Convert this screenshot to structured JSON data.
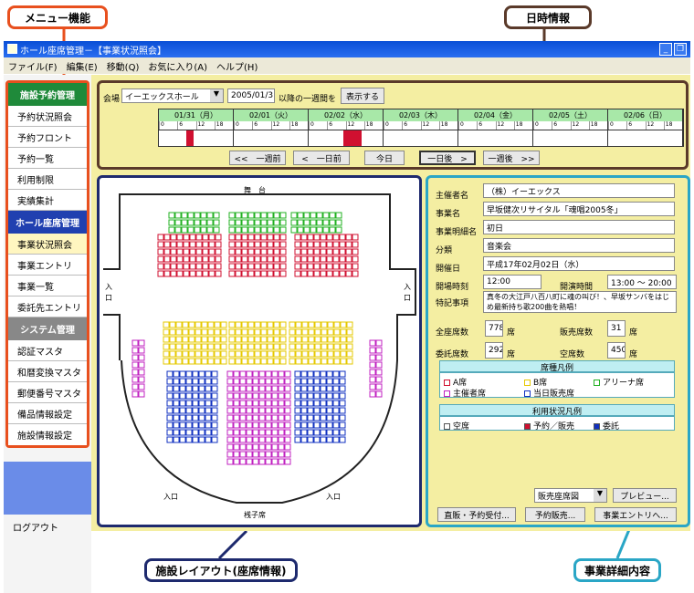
{
  "callouts": {
    "menu": "メニュー機能",
    "datetime": "日時情報",
    "layout": "施設レイアウト(座席情報)",
    "detail": "事業詳細内容"
  },
  "window": {
    "title": "ホール座席管理－【事業状況照会】"
  },
  "menubar": [
    "ファイル(F)",
    "編集(E)",
    "移動(Q)",
    "お気に入り(A)",
    "ヘルプ(H)"
  ],
  "sidebar": {
    "sections": [
      {
        "header": "施設予約管理",
        "color": "#1f8a3a",
        "items": [
          "予約状況照会",
          "予約フロント",
          "予約一覧",
          "利用制限",
          "実績集計"
        ]
      },
      {
        "header": "ホール座席管理",
        "color": "#2040b0",
        "items": [
          "事業状況照会",
          "事業エントリ",
          "事業一覧",
          "委託先エントリ"
        ]
      },
      {
        "header": "システム管理",
        "color": "#888888",
        "items": [
          "認証マスタ",
          "和暦変換マスタ",
          "郵便番号マスタ",
          "備品情報設定",
          "施設情報設定"
        ]
      }
    ],
    "logout": "ログアウト"
  },
  "schedule": {
    "venue_label": "会場",
    "venue_value": "イーエックスホール",
    "date_value": "2005/01/31",
    "range_label": "以降の一週間を",
    "show_button": "表示する",
    "days": [
      "01/31（月）",
      "02/01（火）",
      "02/02（水）",
      "02/03（木）",
      "02/04（金）",
      "02/05（土）",
      "02/06（日）"
    ],
    "hours": [
      "0",
      "6",
      "12",
      "18"
    ],
    "nav": [
      "<<　一週前",
      "<　一日前",
      "今日",
      "一日後　>",
      "一週後　>>"
    ]
  },
  "layout": {
    "stage": "舞　台",
    "entrance": "入口",
    "entrance_left": "入\n口",
    "entrance_right": "入\n口",
    "orchestra": "桟子席"
  },
  "detail": {
    "fields": [
      {
        "label": "主催者名",
        "value": "（株）イーエックス"
      },
      {
        "label": "事業名",
        "value": "早坂健次リサイタル「魂唱2005冬」"
      },
      {
        "label": "事業明細名",
        "value": "初日"
      },
      {
        "label": "分類",
        "value": "音楽会"
      },
      {
        "label": "開催日",
        "value": "平成17年02月02日（水）"
      }
    ],
    "open_label": "開場時刻",
    "open_value": "12:00",
    "perf_label": "開演時間",
    "perf_value": "13:00 ～ 20:00",
    "notes_label": "特記事項",
    "notes_value": "真冬の大江戸八百八町に魂の叫び！、早坂サンバをはじめ最新持ち歌200曲を熱唱！",
    "counts": [
      {
        "label": "全座席数",
        "value": "778",
        "unit": "席"
      },
      {
        "label": "販売席数",
        "value": "31",
        "unit": "席"
      },
      {
        "label": "委託席数",
        "value": "292",
        "unit": "席"
      },
      {
        "label": "空席数",
        "value": "450",
        "unit": "席"
      }
    ],
    "seat_legend_title": "席種凡例",
    "seat_legend": [
      {
        "label": "A席",
        "color": "#d01030"
      },
      {
        "label": "B席",
        "color": "#e6c800"
      },
      {
        "label": "アリーナ席",
        "color": "#22b022"
      },
      {
        "label": "主催者席",
        "color": "#c020c0"
      },
      {
        "label": "当日販売席",
        "color": "#1030c0"
      }
    ],
    "usage_legend_title": "利用状況凡例",
    "usage_legend": [
      {
        "label": "空席",
        "color": "#ffffff"
      },
      {
        "label": "予約／販売",
        "color": "#d01030"
      },
      {
        "label": "委託",
        "color": "#1030c0"
      }
    ],
    "print_select": "販売座席図",
    "preview_button": "プレビュー...",
    "buttons": [
      "直販・予約受付...",
      "予約販売...",
      "事業エントリへ..."
    ]
  }
}
